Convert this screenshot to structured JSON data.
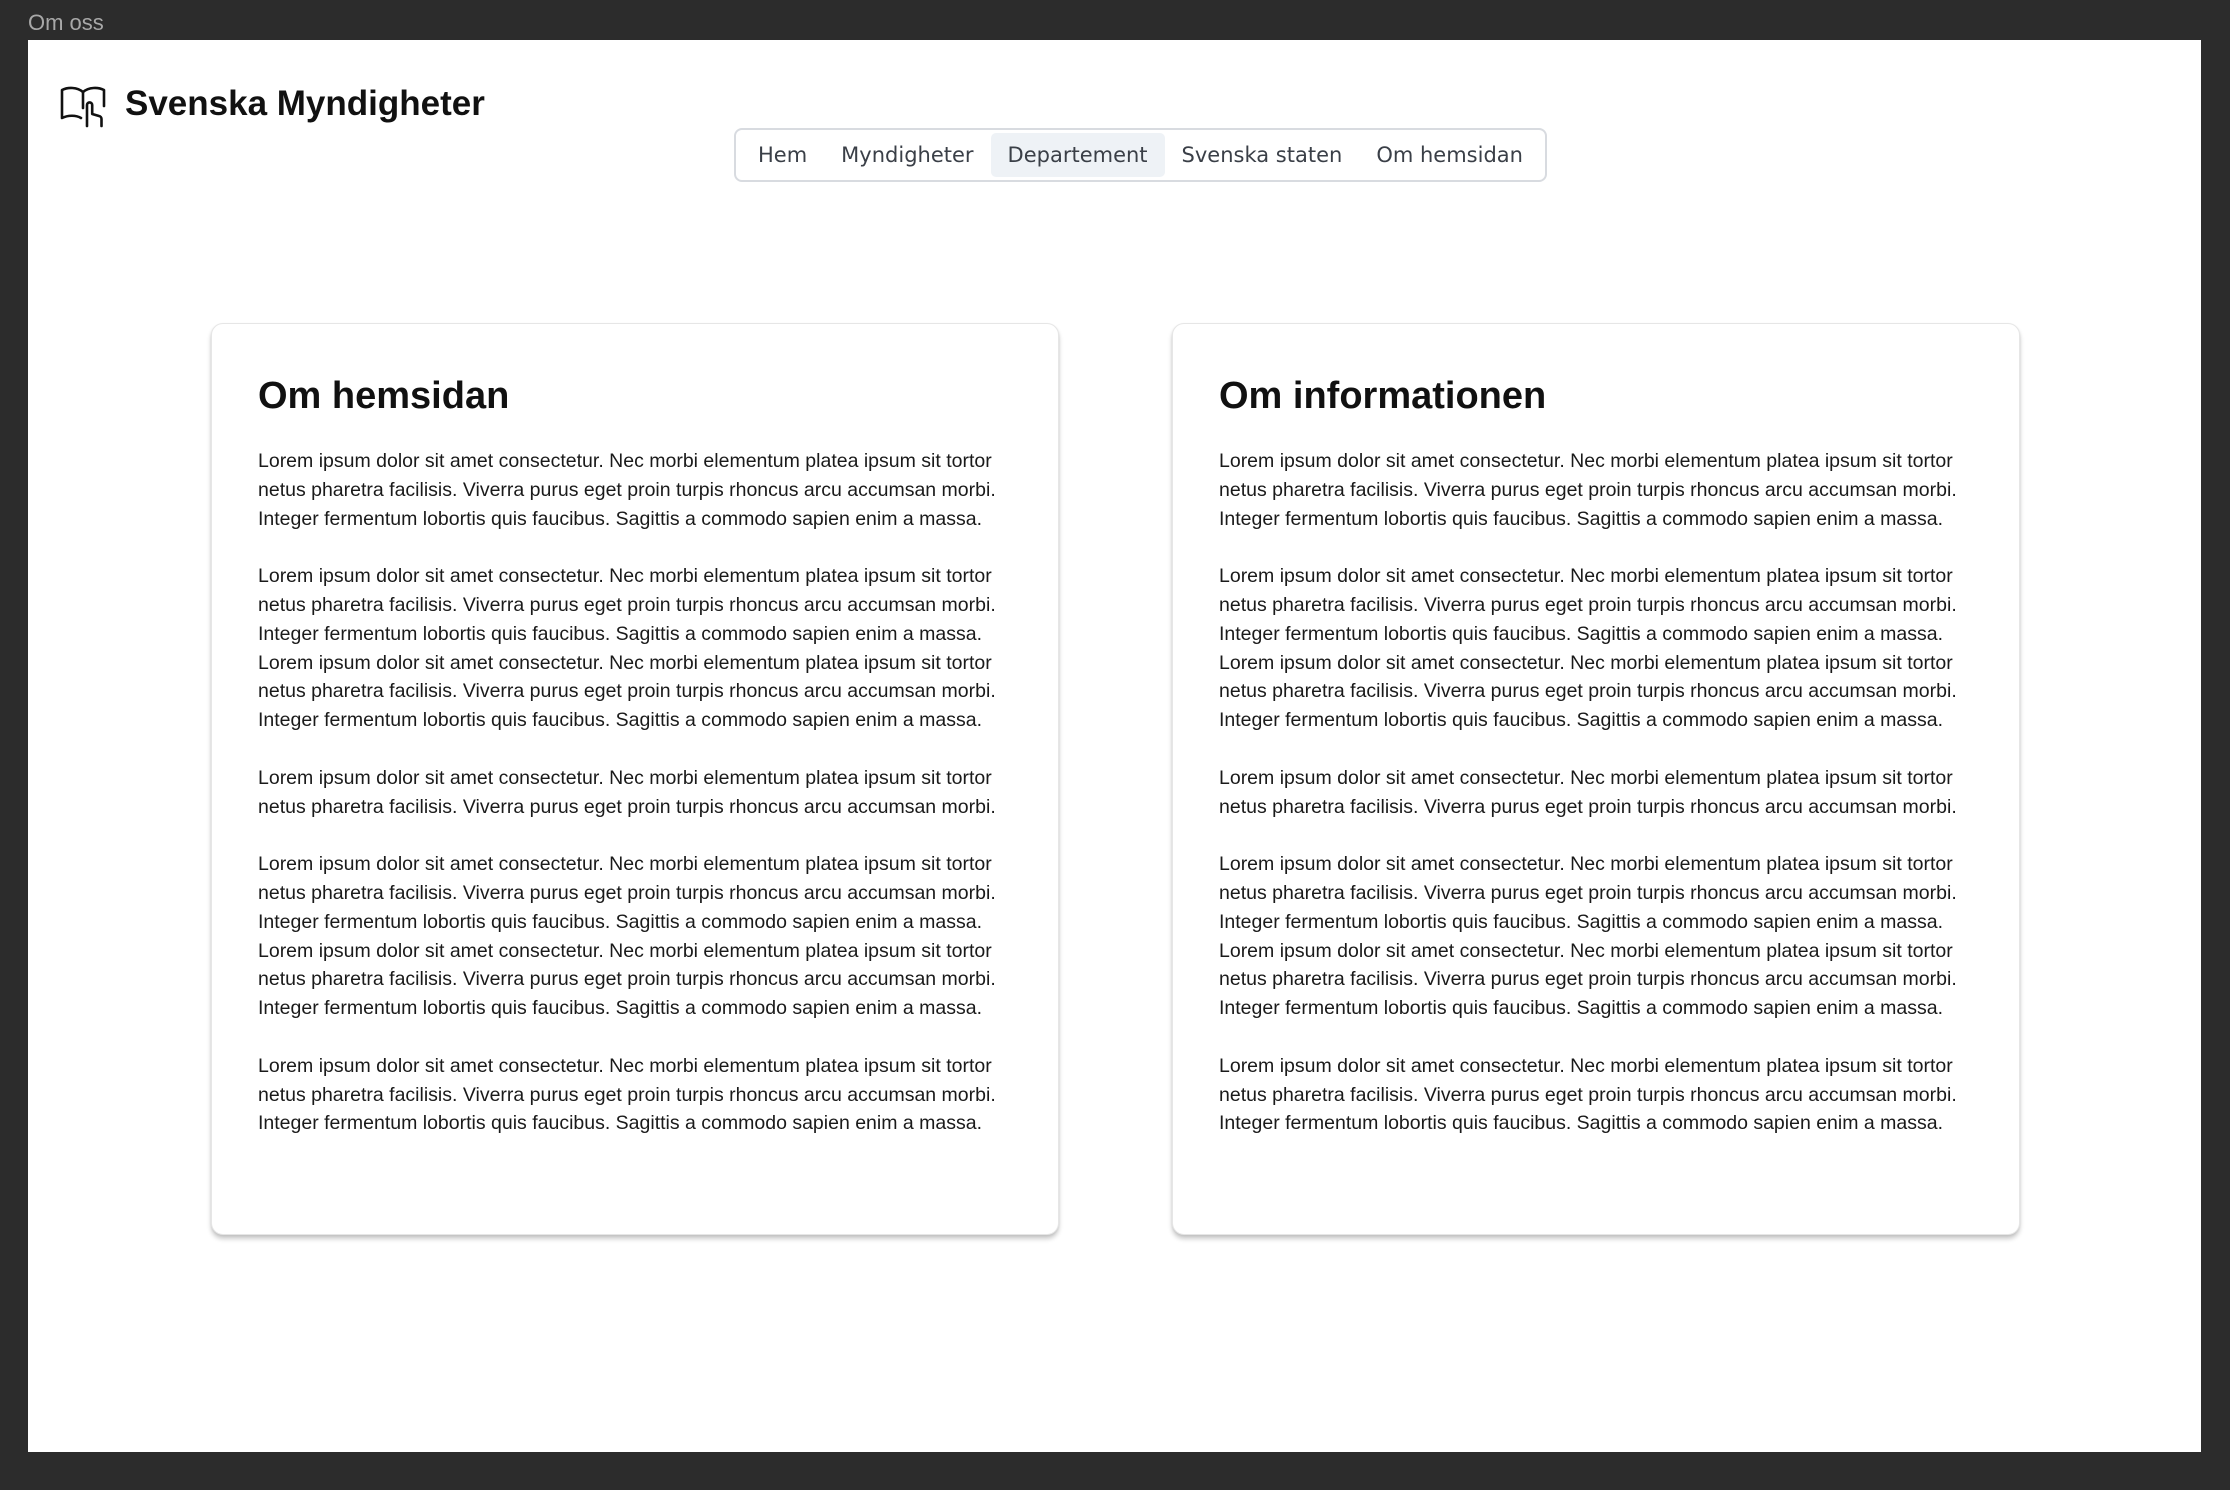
{
  "frame": {
    "label": "Om oss"
  },
  "header": {
    "brand_name": "Svenska Myndigheter",
    "brand_icon": "book-person-icon"
  },
  "nav": {
    "items": [
      {
        "label": "Hem"
      },
      {
        "label": "Myndigheter"
      },
      {
        "label": "Departement",
        "active": true
      },
      {
        "label": "Svenska staten"
      },
      {
        "label": "Om hemsidan"
      }
    ]
  },
  "cards": [
    {
      "title": "Om hemsidan",
      "paragraphs": [
        "Lorem ipsum dolor sit amet consectetur. Nec morbi elementum platea ipsum sit tortor netus pharetra facilisis. Viverra purus eget proin turpis rhoncus arcu accumsan morbi. Integer fermentum lobortis quis faucibus. Sagittis a commodo sapien enim a massa.",
        "Lorem ipsum dolor sit amet consectetur. Nec morbi elementum platea ipsum sit tortor netus pharetra facilisis. Viverra purus eget proin turpis rhoncus arcu accumsan morbi. Integer fermentum lobortis quis faucibus. Sagittis a commodo sapien enim a massa. Lorem ipsum dolor sit amet consectetur. Nec morbi elementum platea ipsum sit tortor netus pharetra facilisis. Viverra purus eget proin turpis rhoncus arcu accumsan morbi. Integer fermentum lobortis quis faucibus. Sagittis a commodo sapien enim a massa.",
        "Lorem ipsum dolor sit amet consectetur. Nec morbi elementum platea ipsum sit tortor netus pharetra facilisis. Viverra purus eget proin turpis rhoncus arcu accumsan morbi.",
        "Lorem ipsum dolor sit amet consectetur. Nec morbi elementum platea ipsum sit tortor netus pharetra facilisis. Viverra purus eget proin turpis rhoncus arcu accumsan morbi. Integer fermentum lobortis quis faucibus. Sagittis a commodo sapien enim a massa. Lorem ipsum dolor sit amet consectetur. Nec morbi elementum platea ipsum sit tortor netus pharetra facilisis. Viverra purus eget proin turpis rhoncus arcu accumsan morbi. Integer fermentum lobortis quis faucibus. Sagittis a commodo sapien enim a massa.",
        "Lorem ipsum dolor sit amet consectetur. Nec morbi elementum platea ipsum sit tortor netus pharetra facilisis. Viverra purus eget proin turpis rhoncus arcu accumsan morbi. Integer fermentum lobortis quis faucibus. Sagittis a commodo sapien enim a massa."
      ]
    },
    {
      "title": "Om informationen",
      "paragraphs": [
        "Lorem ipsum dolor sit amet consectetur. Nec morbi elementum platea ipsum sit tortor netus pharetra facilisis. Viverra purus eget proin turpis rhoncus arcu accumsan morbi. Integer fermentum lobortis quis faucibus. Sagittis a commodo sapien enim a massa.",
        "Lorem ipsum dolor sit amet consectetur. Nec morbi elementum platea ipsum sit tortor netus pharetra facilisis. Viverra purus eget proin turpis rhoncus arcu accumsan morbi. Integer fermentum lobortis quis faucibus. Sagittis a commodo sapien enim a massa. Lorem ipsum dolor sit amet consectetur. Nec morbi elementum platea ipsum sit tortor netus pharetra facilisis. Viverra purus eget proin turpis rhoncus arcu accumsan morbi. Integer fermentum lobortis quis faucibus. Sagittis a commodo sapien enim a massa.",
        "Lorem ipsum dolor sit amet consectetur. Nec morbi elementum platea ipsum sit tortor netus pharetra facilisis. Viverra purus eget proin turpis rhoncus arcu accumsan morbi.",
        "Lorem ipsum dolor sit amet consectetur. Nec morbi elementum platea ipsum sit tortor netus pharetra facilisis. Viverra purus eget proin turpis rhoncus arcu accumsan morbi. Integer fermentum lobortis quis faucibus. Sagittis a commodo sapien enim a massa. Lorem ipsum dolor sit amet consectetur. Nec morbi elementum platea ipsum sit tortor netus pharetra facilisis. Viverra purus eget proin turpis rhoncus arcu accumsan morbi. Integer fermentum lobortis quis faucibus. Sagittis a commodo sapien enim a massa.",
        "Lorem ipsum dolor sit amet consectetur. Nec morbi elementum platea ipsum sit tortor netus pharetra facilisis. Viverra purus eget proin turpis rhoncus arcu accumsan morbi. Integer fermentum lobortis quis faucibus. Sagittis a commodo sapien enim a massa."
      ]
    }
  ],
  "colors": {
    "frame_background": "#2c2c2c",
    "canvas_background": "#ffffff",
    "nav_active_background": "#eef2f6",
    "nav_border": "#d8dbe0",
    "text": "#111111"
  }
}
